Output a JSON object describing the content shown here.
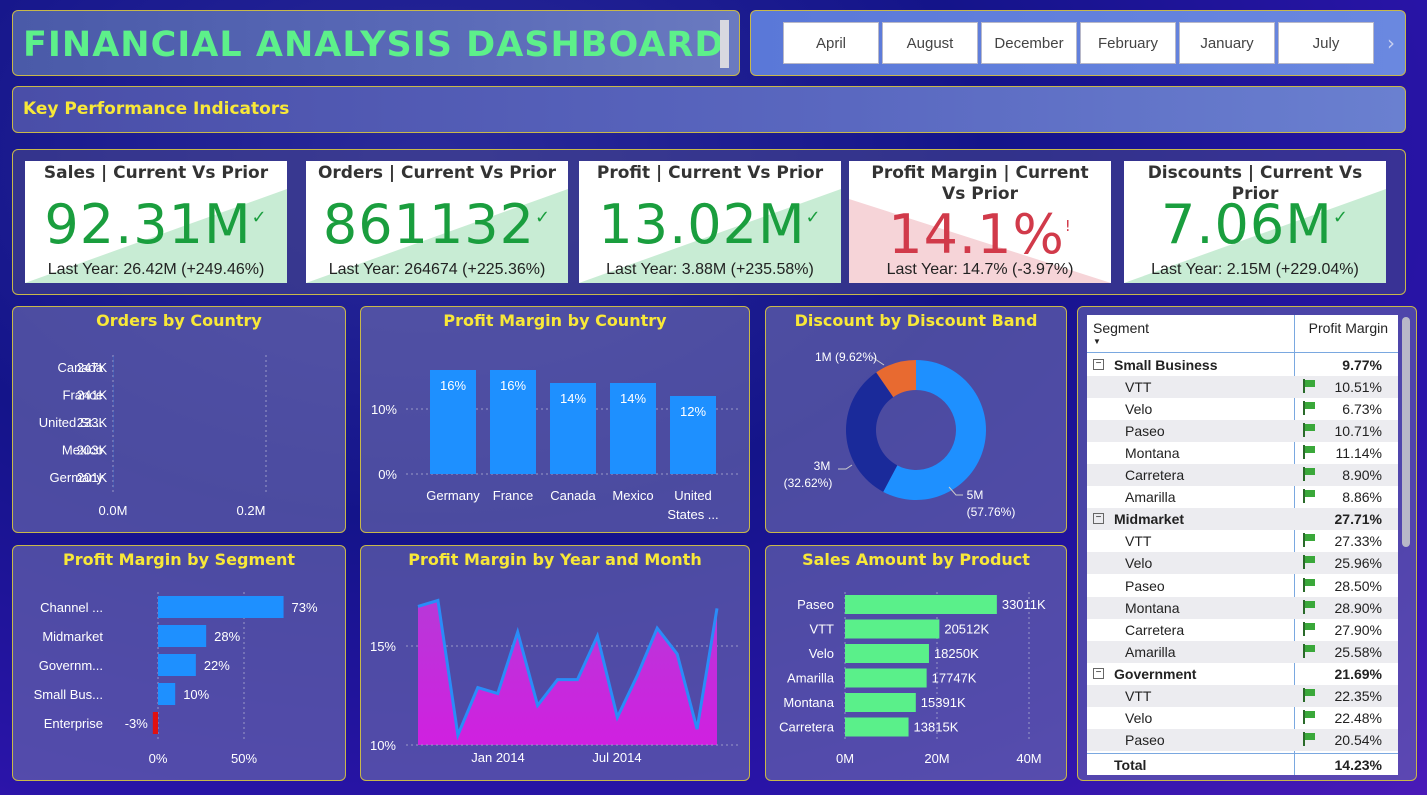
{
  "header": {
    "title": "FINANCIAL ANALYSIS DASHBOARD",
    "months": [
      "April",
      "August",
      "December",
      "February",
      "January",
      "July"
    ],
    "kpi_section_title": "Key Performance Indicators"
  },
  "kpis": [
    {
      "title": "Sales | Current Vs Prior",
      "value": "92.31M",
      "icon": "✓",
      "sub": "Last Year: 26.42M (+249.46%)",
      "status": "up"
    },
    {
      "title": "Orders | Current Vs Prior",
      "value": "861132",
      "icon": "✓",
      "sub": "Last Year: 264674 (+225.36%)",
      "status": "up"
    },
    {
      "title": "Profit | Current Vs Prior",
      "value": "13.02M",
      "icon": "✓",
      "sub": "Last Year: 3.88M (+235.58%)",
      "status": "up"
    },
    {
      "title": "Profit Margin | Current Vs Prior",
      "value": "14.1%",
      "icon": "!",
      "sub": "Last Year: 14.7% (-3.97%)",
      "status": "down"
    },
    {
      "title": "Discounts | Current Vs Prior",
      "value": "7.06M",
      "icon": "✓",
      "sub": "Last Year: 2.15M (+229.04%)",
      "status": "up"
    }
  ],
  "charts": {
    "orders_by_country": {
      "title": "Orders by Country",
      "x_ticks": [
        "0.0M",
        "0.2M"
      ]
    },
    "pm_by_country": {
      "title": "Profit Margin by Country",
      "y_ticks": [
        "10%",
        "0%"
      ]
    },
    "discount_band": {
      "title": "Discount by Discount Band"
    },
    "pm_by_segment": {
      "title": "Profit Margin by Segment",
      "x_ticks": [
        "0%",
        "50%"
      ]
    },
    "pm_by_year_month": {
      "title": "Profit Margin by Year and Month",
      "y_ticks": [
        "15%",
        "10%"
      ],
      "x_ticks": [
        "Jan 2014",
        "Jul 2014"
      ]
    },
    "sales_by_product": {
      "title": "Sales Amount by Product",
      "x_ticks": [
        "0M",
        "20M",
        "40M"
      ]
    }
  },
  "chart_data": [
    {
      "type": "bar",
      "orientation": "horizontal",
      "title": "Orders by Country",
      "categories": [
        "Canada",
        "France",
        "United St...",
        "Mexico",
        "Germany"
      ],
      "values": [
        247,
        241,
        233,
        203,
        201
      ],
      "labels": [
        "247K",
        "241K",
        "233K",
        "203K",
        "201K"
      ],
      "xlim": [
        0,
        0.2
      ]
    },
    {
      "type": "bar",
      "title": "Profit Margin by Country",
      "categories": [
        "Germany",
        "France",
        "Canada",
        "Mexico",
        "United States ..."
      ],
      "values": [
        16,
        16,
        14,
        14,
        12
      ],
      "labels": [
        "16%",
        "16%",
        "14%",
        "14%",
        "12%"
      ],
      "ylim": [
        0,
        18
      ]
    },
    {
      "type": "pie",
      "title": "Discount by Discount Band",
      "slices": [
        {
          "label": "5M",
          "pct": "(57.76%)",
          "value": 57.76,
          "color": "#1e90ff"
        },
        {
          "label": "3M",
          "pct": "(32.62%)",
          "value": 32.62,
          "color": "#1a2a9a"
        },
        {
          "label": "1M",
          "pct": "(9.62%)",
          "value": 9.62,
          "color": "#e86a30"
        }
      ]
    },
    {
      "type": "bar",
      "orientation": "horizontal",
      "title": "Profit Margin by Segment",
      "categories": [
        "Channel ...",
        "Midmarket",
        "Governm...",
        "Small Bus...",
        "Enterprise"
      ],
      "values": [
        73,
        28,
        22,
        10,
        -3
      ],
      "labels": [
        "73%",
        "28%",
        "22%",
        "10%",
        "-3%"
      ],
      "xlim": [
        -5,
        80
      ]
    },
    {
      "type": "area",
      "title": "Profit Margin by Year and Month",
      "x": [
        "2013-09",
        "2013-10",
        "2013-11",
        "2013-12",
        "2014-01",
        "2014-02",
        "2014-03",
        "2014-04",
        "2014-05",
        "2014-06",
        "2014-07",
        "2014-08",
        "2014-09",
        "2014-10",
        "2014-11",
        "2014-12"
      ],
      "values": [
        17.0,
        17.3,
        10.5,
        12.9,
        12.6,
        15.7,
        12.0,
        13.3,
        13.3,
        15.5,
        11.4,
        13.5,
        15.9,
        14.6,
        10.8,
        16.9
      ],
      "ylim": [
        10,
        17.5
      ]
    },
    {
      "type": "bar",
      "orientation": "horizontal",
      "title": "Sales Amount by Product",
      "categories": [
        "Paseo",
        "VTT",
        "Velo",
        "Amarilla",
        "Montana",
        "Carretera"
      ],
      "values": [
        33011,
        20512,
        18250,
        17747,
        15391,
        13815
      ],
      "labels": [
        "33011K",
        "20512K",
        "18250K",
        "17747K",
        "15391K",
        "13815K"
      ],
      "xlim": [
        0,
        40000
      ]
    }
  ],
  "table": {
    "headers": [
      "Segment",
      "Profit Margin"
    ],
    "rows": [
      {
        "type": "seg",
        "label": "Small Business",
        "pm": "9.77%",
        "expander": "⊟"
      },
      {
        "type": "item",
        "label": "VTT",
        "pm": "10.51%"
      },
      {
        "type": "item",
        "label": "Velo",
        "pm": "6.73%"
      },
      {
        "type": "item",
        "label": "Paseo",
        "pm": "10.71%"
      },
      {
        "type": "item",
        "label": "Montana",
        "pm": "11.14%"
      },
      {
        "type": "item",
        "label": "Carretera",
        "pm": "8.90%"
      },
      {
        "type": "item",
        "label": "Amarilla",
        "pm": "8.86%"
      },
      {
        "type": "seg",
        "label": "Midmarket",
        "pm": "27.71%",
        "expander": "⊟"
      },
      {
        "type": "item",
        "label": "VTT",
        "pm": "27.33%"
      },
      {
        "type": "item",
        "label": "Velo",
        "pm": "25.96%"
      },
      {
        "type": "item",
        "label": "Paseo",
        "pm": "28.50%"
      },
      {
        "type": "item",
        "label": "Montana",
        "pm": "28.90%"
      },
      {
        "type": "item",
        "label": "Carretera",
        "pm": "27.90%"
      },
      {
        "type": "item",
        "label": "Amarilla",
        "pm": "25.58%"
      },
      {
        "type": "seg",
        "label": "Government",
        "pm": "21.69%",
        "expander": "⊟"
      },
      {
        "type": "item",
        "label": "VTT",
        "pm": "22.35%"
      },
      {
        "type": "item",
        "label": "Velo",
        "pm": "22.48%"
      },
      {
        "type": "item",
        "label": "Paseo",
        "pm": "20.54%"
      }
    ],
    "total": {
      "label": "Total",
      "pm": "14.23%"
    }
  },
  "colors": {
    "bar_blue": "#1e90ff",
    "bar_green": "#5af08a",
    "up_green": "#1a9e3e",
    "down_red": "#d13a4a",
    "title_yellow": "#f8e838",
    "area_magenta": "#c030d8"
  }
}
